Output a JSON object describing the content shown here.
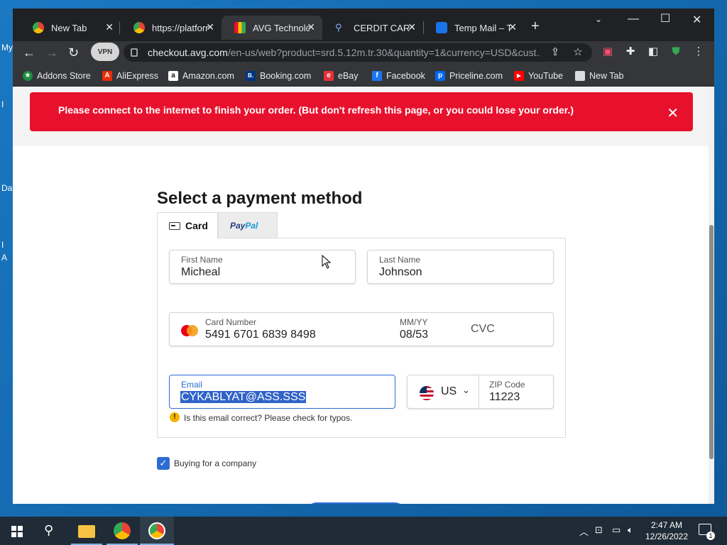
{
  "desktop": {
    "labels": [
      "My",
      "I",
      "Da",
      "I",
      "A"
    ]
  },
  "browser": {
    "tabs": [
      {
        "title": "New Tab",
        "favicon_color": "#fbbc04"
      },
      {
        "title": "https://platform",
        "favicon_color": "#fbbc04"
      },
      {
        "title": "AVG Technologies",
        "favicon_color": "#e8112d"
      },
      {
        "title": "CERDIT CARD",
        "favicon_color": "#4285f4"
      },
      {
        "title": "Temp Mail – Te",
        "favicon_color": "#1a73e8"
      }
    ],
    "active_tab_index": 2,
    "vpn_label": "VPN",
    "url_host": "checkout.avg.com",
    "url_path": "/en-us/web?product=srd.5.12m.tr.30&quantity=1&currency=USD&cust...",
    "bookmarks": [
      {
        "label": "Addons Store",
        "color": "#1e8e3e",
        "glyph": "★"
      },
      {
        "label": "AliExpress",
        "color": "#e62e04",
        "glyph": "A"
      },
      {
        "label": "Amazon.com",
        "color": "#ffffff",
        "glyph": "a"
      },
      {
        "label": "Booking.com",
        "color": "#003580",
        "glyph": "B."
      },
      {
        "label": "eBay",
        "color": "#e53238",
        "glyph": "e"
      },
      {
        "label": "Facebook",
        "color": "#1877f2",
        "glyph": "f"
      },
      {
        "label": "Priceline.com",
        "color": "#0068ef",
        "glyph": "p"
      },
      {
        "label": "YouTube",
        "color": "#ff0000",
        "glyph": "▶"
      },
      {
        "label": "New Tab",
        "color": "#dadce0",
        "glyph": ""
      }
    ]
  },
  "alert": {
    "message": "Please connect to the internet to finish your order. (But don't refresh this page, or you could lose your order.)",
    "close": "✕"
  },
  "payment": {
    "title": "Select a payment method",
    "tab_card": "Card",
    "tab_paypal_1": "Pay",
    "tab_paypal_2": "Pal",
    "first_name_label": "First Name",
    "first_name": "Micheal",
    "last_name_label": "Last Name",
    "last_name": "Johnson",
    "card_number_label": "Card Number",
    "card_number": "5491 6701 6839 8498",
    "expiry_label": "MM/YY",
    "expiry": "08/53",
    "cvc_placeholder": "CVC",
    "email_label": "Email",
    "email": "CYKABLYAT@ASS.SSS",
    "email_warning": "Is this email correct? Please check for typos.",
    "country": "US",
    "zip_label": "ZIP Code",
    "zip": "11223",
    "company_checkbox_label": "Buying for a company",
    "company_checked": true
  },
  "taskbar": {
    "time": "2:47 AM",
    "date": "12/26/2022",
    "notifications": "1"
  },
  "colors": {
    "accent": "#2d6dd2",
    "alert": "#e8112d"
  }
}
